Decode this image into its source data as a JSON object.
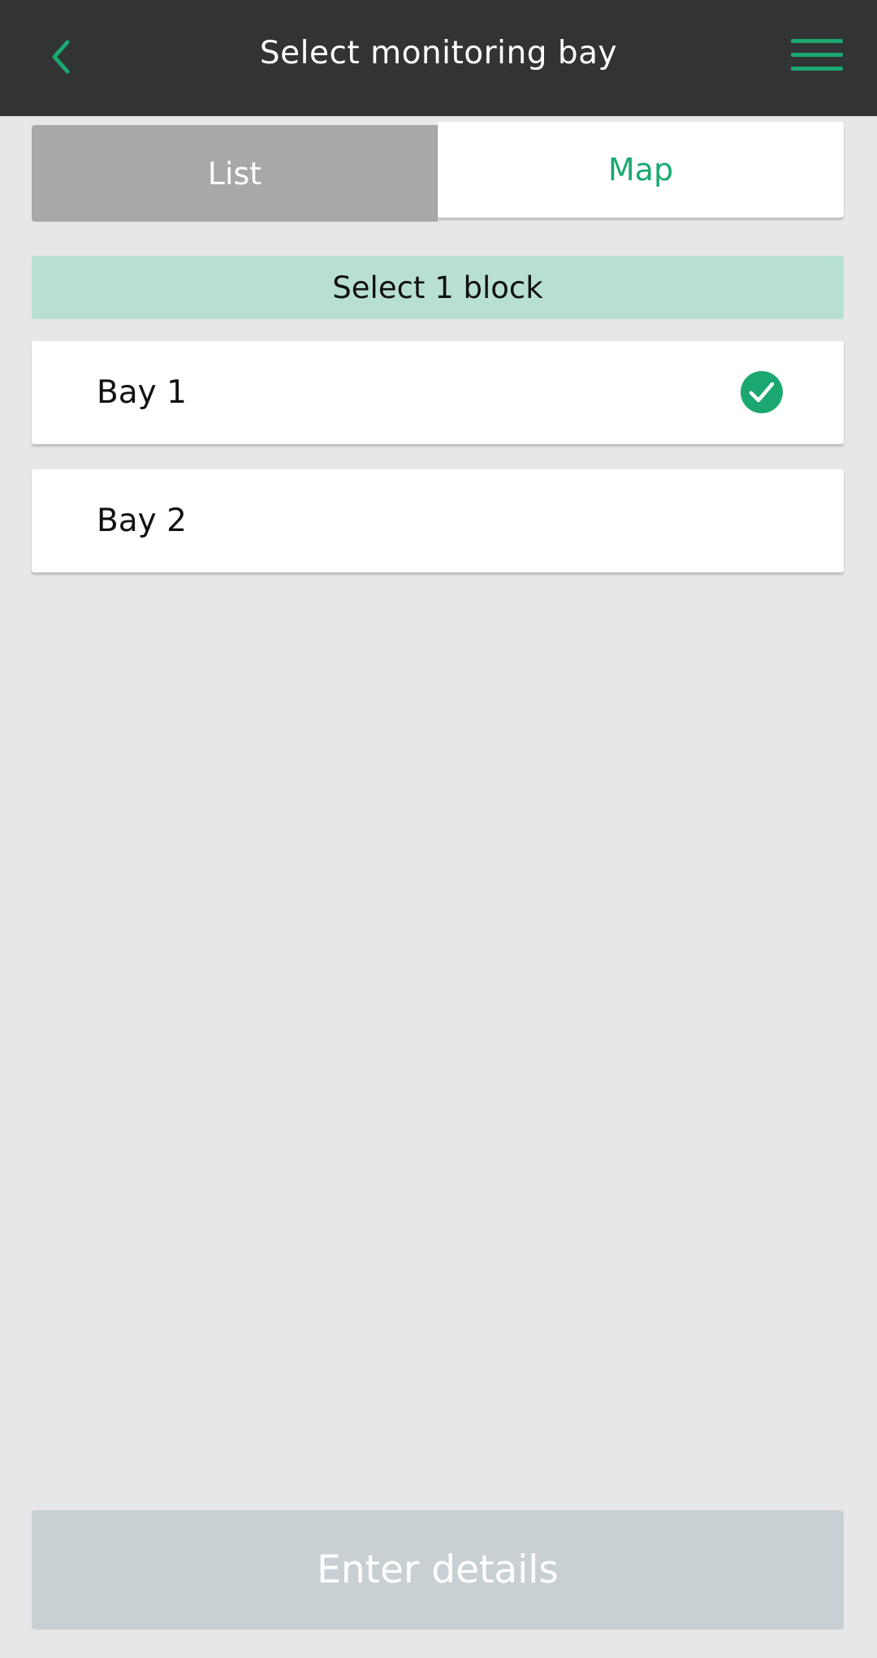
{
  "header": {
    "title": "Select monitoring bay",
    "back_icon": "chevron-left-icon",
    "menu_icon": "hamburger-menu-icon"
  },
  "tabs": [
    {
      "label": "List",
      "active": false
    },
    {
      "label": "Map",
      "active": true
    }
  ],
  "banner": {
    "text": "Select 1 block"
  },
  "bays": [
    {
      "label": "Bay 1",
      "selected": true
    },
    {
      "label": "Bay 2",
      "selected": false
    }
  ],
  "footer": {
    "button_label": "Enter details",
    "enabled": false
  },
  "colors": {
    "header_bg": "#313335",
    "accent": "#1ba870",
    "banner_bg": "#b8e0d2",
    "inactive_tab": "#a8a8aa",
    "disabled_button": "#c9d0d4",
    "page_bg": "#e7e6e9"
  }
}
